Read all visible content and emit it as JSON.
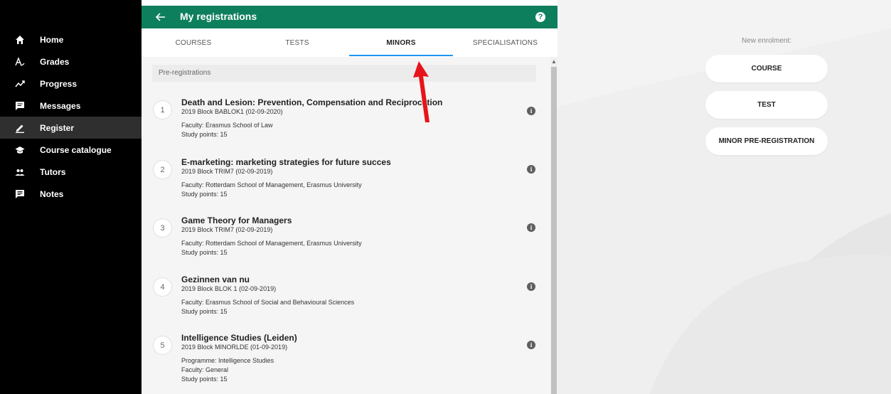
{
  "sidebar": {
    "items": [
      {
        "label": "Home",
        "icon": "home-icon"
      },
      {
        "label": "Grades",
        "icon": "grades-icon"
      },
      {
        "label": "Progress",
        "icon": "progress-icon"
      },
      {
        "label": "Messages",
        "icon": "messages-icon"
      },
      {
        "label": "Register",
        "icon": "pencil-icon",
        "active": true
      },
      {
        "label": "Course catalogue",
        "icon": "graduation-cap-icon"
      },
      {
        "label": "Tutors",
        "icon": "people-icon"
      },
      {
        "label": "Notes",
        "icon": "notes-icon"
      }
    ]
  },
  "header": {
    "title": "My registrations",
    "help": "?"
  },
  "tabs": [
    {
      "label": "COURSES"
    },
    {
      "label": "TESTS"
    },
    {
      "label": "MINORS",
      "active": true
    },
    {
      "label": "SPECIALISATIONS"
    }
  ],
  "section_label": "Pre-registrations",
  "registrations": [
    {
      "num": "1",
      "title": "Death and Lesion: Prevention, Compensation and Reciprocation",
      "lines": [
        "2019 Block BABLOK1 (02-09-2020)",
        "Faculty: Erasmus School of Law",
        "Study points: 15"
      ]
    },
    {
      "num": "2",
      "title": "E-marketing: marketing strategies for future succes",
      "lines": [
        "2019 Block TRIM7 (02-09-2019)",
        "Faculty: Rotterdam School of Management, Erasmus University",
        "Study points: 15"
      ]
    },
    {
      "num": "3",
      "title": "Game Theory for Managers",
      "lines": [
        "2019 Block TRIM7 (02-09-2019)",
        "Faculty: Rotterdam School of Management, Erasmus University",
        "Study points: 15"
      ]
    },
    {
      "num": "4",
      "title": "Gezinnen van nu",
      "lines": [
        "2019 Block BLOK 1 (02-09-2019)",
        "Faculty: Erasmus School of Social and Behavioural Sciences",
        "Study points: 15"
      ]
    },
    {
      "num": "5",
      "title": "Intelligence Studies (Leiden)",
      "lines": [
        "2019 Block MINORLDE (01-09-2019)",
        "Programme: Intelligence Studies",
        "Faculty: General",
        "Study points: 15"
      ]
    }
  ],
  "info_glyph": "i",
  "enrolment": {
    "label": "New enrolment:",
    "buttons": [
      "COURSE",
      "TEST",
      "MINOR PRE-REGISTRATION"
    ]
  },
  "colors": {
    "header": "#0e7f5c",
    "tab_indicator": "#2196f3",
    "annotation_arrow": "#e8141b"
  }
}
